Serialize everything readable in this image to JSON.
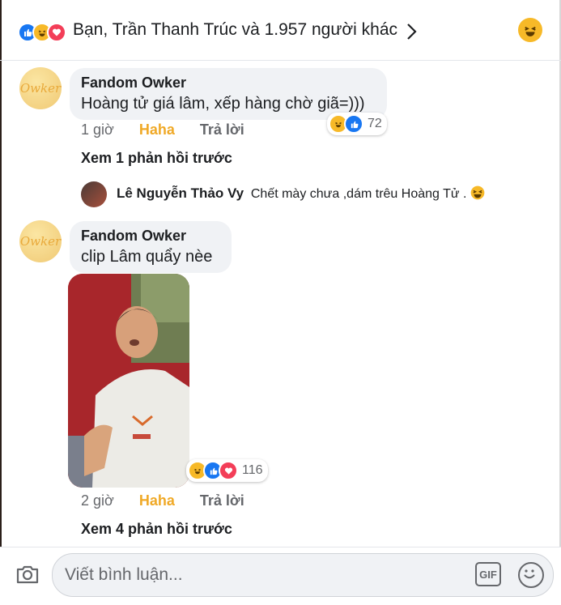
{
  "header": {
    "summary": "Bạn, Trần Thanh Trúc và 1.957 người khác"
  },
  "comments": [
    {
      "author": "Fandom Owker",
      "avatar_text": "Owker",
      "text": "Hoàng tử giá lâm, xếp hàng chờ giã=)))",
      "time": "1 giờ",
      "haha_label": "Haha",
      "reply_label": "Trả lời",
      "reaction_count": "72",
      "view_previous": "Xem 1 phản hồi trước",
      "reply": {
        "author": "Lê Nguyễn Thảo Vy",
        "text": "Chết mày chưa ,dám trêu Hoàng Tử ."
      }
    },
    {
      "author": "Fandom Owker",
      "avatar_text": "Owker",
      "text": "clip Lâm quẩy nèe",
      "time": "2 giờ",
      "haha_label": "Haha",
      "reply_label": "Trả lời",
      "reaction_count": "116",
      "view_previous": "Xem 4 phản hồi trước"
    }
  ],
  "composer": {
    "placeholder": "Viết bình luận...",
    "gif_label": "GIF"
  },
  "colors": {
    "like": "#1877f2",
    "haha": "#f7b928",
    "love": "#f33e58",
    "haha_text": "#f0a927"
  }
}
